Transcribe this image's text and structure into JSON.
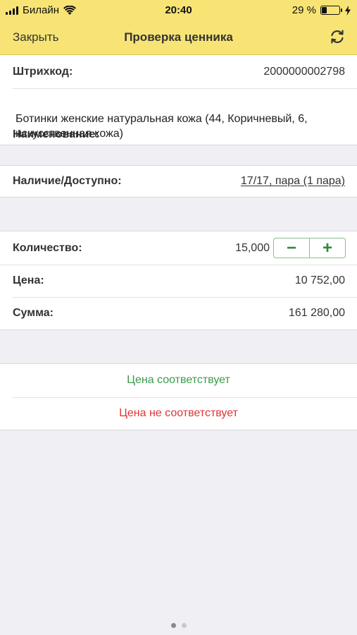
{
  "status_bar": {
    "carrier": "Билайн",
    "time": "20:40",
    "battery_text": "29 %",
    "battery_level": 0.29
  },
  "nav": {
    "close_label": "Закрыть",
    "title": "Проверка ценника",
    "refresh_icon": "refresh-icon"
  },
  "product": {
    "barcode_label": "Штрихкод:",
    "barcode_value": "2000000002798",
    "name_label": "Наименование:",
    "name_value": "Ботинки женские натуральная кожа (44, Коричневый, 6, искусственная кожа)"
  },
  "stock": {
    "label": "Наличие/Доступно:",
    "value": "17/17, пара (1 пара)"
  },
  "quantity": {
    "label": "Количество:",
    "value": "15,000",
    "minus_label": "−",
    "plus_label": "+"
  },
  "price": {
    "label": "Цена:",
    "value": "10 752,00"
  },
  "sum": {
    "label": "Сумма:",
    "value": "161 280,00"
  },
  "actions": {
    "match_label": "Цена соответствует",
    "mismatch_label": "Цена не соответствует"
  },
  "page_indicator": {
    "count": 2,
    "current": 1
  },
  "colors": {
    "header_bg": "#f7e475",
    "success": "#3b9a4a",
    "danger": "#e03434"
  }
}
